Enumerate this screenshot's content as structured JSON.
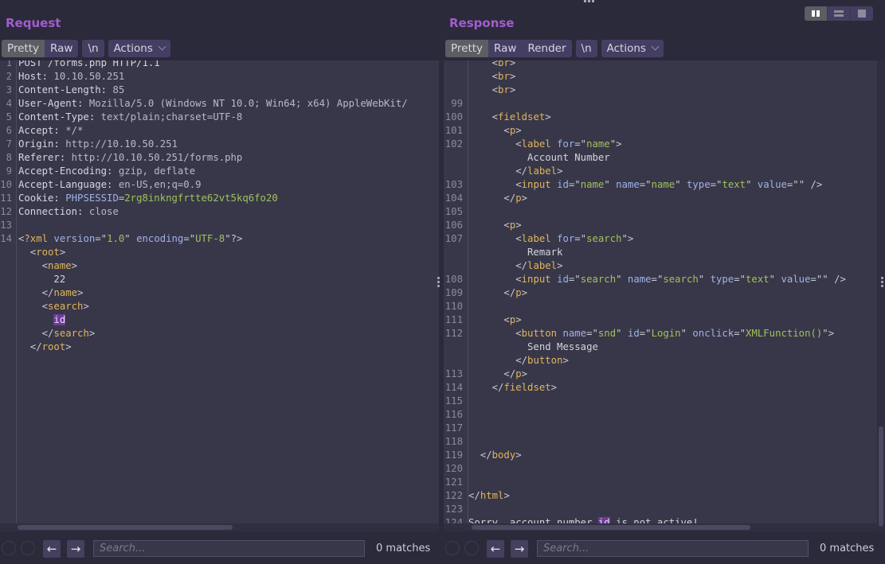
{
  "layout_switch": [
    "side-by-side",
    "stacked",
    "single"
  ],
  "request": {
    "title": "Request",
    "tabs": [
      {
        "label": "Pretty",
        "active": true
      },
      {
        "label": "Raw",
        "active": false
      }
    ],
    "newline_label": "\\n",
    "actions_label": "Actions",
    "lines": [
      {
        "n": "1",
        "parts": [
          {
            "c": "hk",
            "t": "POST /forms.php HTTP/1.1"
          }
        ]
      },
      {
        "n": "2",
        "parts": [
          {
            "c": "hk",
            "t": "Host: "
          },
          {
            "c": "hv",
            "t": "10.10.50.251"
          }
        ]
      },
      {
        "n": "3",
        "parts": [
          {
            "c": "hk",
            "t": "Content-Length: "
          },
          {
            "c": "hv",
            "t": "85"
          }
        ]
      },
      {
        "n": "4",
        "parts": [
          {
            "c": "hk",
            "t": "User-Agent: "
          },
          {
            "c": "hv",
            "t": "Mozilla/5.0 (Windows NT 10.0; Win64; x64) AppleWebKit/"
          }
        ]
      },
      {
        "n": "5",
        "parts": [
          {
            "c": "hk",
            "t": "Content-Type: "
          },
          {
            "c": "hv",
            "t": "text/plain;charset=UTF-8"
          }
        ]
      },
      {
        "n": "6",
        "parts": [
          {
            "c": "hk",
            "t": "Accept: "
          },
          {
            "c": "hv",
            "t": "*/*"
          }
        ]
      },
      {
        "n": "7",
        "parts": [
          {
            "c": "hk",
            "t": "Origin: "
          },
          {
            "c": "hv",
            "t": "http://10.10.50.251"
          }
        ]
      },
      {
        "n": "8",
        "parts": [
          {
            "c": "hk",
            "t": "Referer: "
          },
          {
            "c": "hv",
            "t": "http://10.10.50.251/forms.php"
          }
        ]
      },
      {
        "n": "9",
        "parts": [
          {
            "c": "hk",
            "t": "Accept-Encoding: "
          },
          {
            "c": "hv",
            "t": "gzip, deflate"
          }
        ]
      },
      {
        "n": "10",
        "parts": [
          {
            "c": "hk",
            "t": "Accept-Language: "
          },
          {
            "c": "hv",
            "t": "en-US,en;q=0.9"
          }
        ]
      },
      {
        "n": "11",
        "parts": [
          {
            "c": "hk",
            "t": "Cookie: "
          },
          {
            "c": "attr",
            "t": "PHPSESSID"
          },
          {
            "c": "punct",
            "t": "="
          },
          {
            "c": "cookie",
            "t": "2rg8inkngfrtte62vt5kq6fo20"
          }
        ]
      },
      {
        "n": "12",
        "parts": [
          {
            "c": "hk",
            "t": "Connection: "
          },
          {
            "c": "hv",
            "t": "close"
          }
        ]
      },
      {
        "n": "13",
        "parts": []
      },
      {
        "n": "14",
        "parts": [
          {
            "c": "punct",
            "t": "<"
          },
          {
            "c": "tag",
            "t": "?xml "
          },
          {
            "c": "attr",
            "t": "version"
          },
          {
            "c": "punct",
            "t": "=\""
          },
          {
            "c": "str",
            "t": "1.0"
          },
          {
            "c": "punct",
            "t": "\" "
          },
          {
            "c": "attr",
            "t": "encoding"
          },
          {
            "c": "punct",
            "t": "=\""
          },
          {
            "c": "str",
            "t": "UTF-8"
          },
          {
            "c": "punct",
            "t": "\"?>"
          }
        ]
      },
      {
        "n": "",
        "parts": [
          {
            "c": "txt",
            "t": "  "
          },
          {
            "c": "punct",
            "t": "<"
          },
          {
            "c": "tag",
            "t": "root"
          },
          {
            "c": "punct",
            "t": ">"
          }
        ]
      },
      {
        "n": "",
        "parts": [
          {
            "c": "txt",
            "t": "    "
          },
          {
            "c": "punct",
            "t": "<"
          },
          {
            "c": "tag",
            "t": "name"
          },
          {
            "c": "punct",
            "t": ">"
          }
        ]
      },
      {
        "n": "",
        "parts": [
          {
            "c": "txt",
            "t": "      22"
          }
        ]
      },
      {
        "n": "",
        "parts": [
          {
            "c": "txt",
            "t": "    "
          },
          {
            "c": "punct",
            "t": "</"
          },
          {
            "c": "tag",
            "t": "name"
          },
          {
            "c": "punct",
            "t": ">"
          }
        ]
      },
      {
        "n": "",
        "parts": [
          {
            "c": "txt",
            "t": "    "
          },
          {
            "c": "punct",
            "t": "<"
          },
          {
            "c": "tag",
            "t": "search"
          },
          {
            "c": "punct",
            "t": ">"
          }
        ]
      },
      {
        "n": "",
        "parts": [
          {
            "c": "txt",
            "t": "      "
          },
          {
            "c": "hl",
            "t": "id"
          }
        ]
      },
      {
        "n": "",
        "parts": [
          {
            "c": "txt",
            "t": "    "
          },
          {
            "c": "punct",
            "t": "</"
          },
          {
            "c": "tag",
            "t": "search"
          },
          {
            "c": "punct",
            "t": ">"
          }
        ]
      },
      {
        "n": "",
        "parts": [
          {
            "c": "txt",
            "t": "  "
          },
          {
            "c": "punct",
            "t": "</"
          },
          {
            "c": "tag",
            "t": "root"
          },
          {
            "c": "punct",
            "t": ">"
          }
        ]
      }
    ],
    "search_placeholder": "Search...",
    "search_value": "",
    "matches": "0 matches"
  },
  "response": {
    "title": "Response",
    "tabs": [
      {
        "label": "Pretty",
        "active": true
      },
      {
        "label": "Raw",
        "active": false
      },
      {
        "label": "Render",
        "active": false
      }
    ],
    "newline_label": "\\n",
    "actions_label": "Actions",
    "lines": [
      {
        "n": "",
        "parts": [
          {
            "c": "txt",
            "t": "    "
          },
          {
            "c": "punct",
            "t": "<"
          },
          {
            "c": "tag",
            "t": "br"
          },
          {
            "c": "punct",
            "t": ">"
          }
        ]
      },
      {
        "n": "",
        "parts": [
          {
            "c": "txt",
            "t": "    "
          },
          {
            "c": "punct",
            "t": "<"
          },
          {
            "c": "tag",
            "t": "br"
          },
          {
            "c": "punct",
            "t": ">"
          }
        ]
      },
      {
        "n": "",
        "parts": [
          {
            "c": "txt",
            "t": "    "
          },
          {
            "c": "punct",
            "t": "<"
          },
          {
            "c": "tag",
            "t": "br"
          },
          {
            "c": "punct",
            "t": ">"
          }
        ]
      },
      {
        "n": "99",
        "parts": []
      },
      {
        "n": "100",
        "parts": [
          {
            "c": "txt",
            "t": "    "
          },
          {
            "c": "punct",
            "t": "<"
          },
          {
            "c": "tag",
            "t": "fieldset"
          },
          {
            "c": "punct",
            "t": ">"
          }
        ]
      },
      {
        "n": "101",
        "parts": [
          {
            "c": "txt",
            "t": "      "
          },
          {
            "c": "punct",
            "t": "<"
          },
          {
            "c": "tag",
            "t": "p"
          },
          {
            "c": "punct",
            "t": ">"
          }
        ]
      },
      {
        "n": "102",
        "parts": [
          {
            "c": "txt",
            "t": "        "
          },
          {
            "c": "punct",
            "t": "<"
          },
          {
            "c": "tag",
            "t": "label "
          },
          {
            "c": "attr",
            "t": "for"
          },
          {
            "c": "punct",
            "t": "=\""
          },
          {
            "c": "str",
            "t": "name"
          },
          {
            "c": "punct",
            "t": "\">"
          }
        ]
      },
      {
        "n": "",
        "parts": [
          {
            "c": "txt",
            "t": "          Account Number"
          }
        ]
      },
      {
        "n": "",
        "parts": [
          {
            "c": "txt",
            "t": "        "
          },
          {
            "c": "punct",
            "t": "</"
          },
          {
            "c": "tag",
            "t": "label"
          },
          {
            "c": "punct",
            "t": ">"
          }
        ]
      },
      {
        "n": "103",
        "parts": [
          {
            "c": "txt",
            "t": "        "
          },
          {
            "c": "punct",
            "t": "<"
          },
          {
            "c": "tag",
            "t": "input "
          },
          {
            "c": "attr",
            "t": "id"
          },
          {
            "c": "punct",
            "t": "=\""
          },
          {
            "c": "str",
            "t": "name"
          },
          {
            "c": "punct",
            "t": "\" "
          },
          {
            "c": "attr",
            "t": "name"
          },
          {
            "c": "punct",
            "t": "=\""
          },
          {
            "c": "str",
            "t": "name"
          },
          {
            "c": "punct",
            "t": "\" "
          },
          {
            "c": "attr",
            "t": "type"
          },
          {
            "c": "punct",
            "t": "=\""
          },
          {
            "c": "str",
            "t": "text"
          },
          {
            "c": "punct",
            "t": "\" "
          },
          {
            "c": "attr",
            "t": "value"
          },
          {
            "c": "punct",
            "t": "=\"\" />"
          }
        ]
      },
      {
        "n": "104",
        "parts": [
          {
            "c": "txt",
            "t": "      "
          },
          {
            "c": "punct",
            "t": "</"
          },
          {
            "c": "tag",
            "t": "p"
          },
          {
            "c": "punct",
            "t": ">"
          }
        ]
      },
      {
        "n": "105",
        "parts": []
      },
      {
        "n": "106",
        "parts": [
          {
            "c": "txt",
            "t": "      "
          },
          {
            "c": "punct",
            "t": "<"
          },
          {
            "c": "tag",
            "t": "p"
          },
          {
            "c": "punct",
            "t": ">"
          }
        ]
      },
      {
        "n": "107",
        "parts": [
          {
            "c": "txt",
            "t": "        "
          },
          {
            "c": "punct",
            "t": "<"
          },
          {
            "c": "tag",
            "t": "label "
          },
          {
            "c": "attr",
            "t": "for"
          },
          {
            "c": "punct",
            "t": "=\""
          },
          {
            "c": "str",
            "t": "search"
          },
          {
            "c": "punct",
            "t": "\">"
          }
        ]
      },
      {
        "n": "",
        "parts": [
          {
            "c": "txt",
            "t": "          Remark"
          }
        ]
      },
      {
        "n": "",
        "parts": [
          {
            "c": "txt",
            "t": "        "
          },
          {
            "c": "punct",
            "t": "</"
          },
          {
            "c": "tag",
            "t": "label"
          },
          {
            "c": "punct",
            "t": ">"
          }
        ]
      },
      {
        "n": "108",
        "parts": [
          {
            "c": "txt",
            "t": "        "
          },
          {
            "c": "punct",
            "t": "<"
          },
          {
            "c": "tag",
            "t": "input "
          },
          {
            "c": "attr",
            "t": "id"
          },
          {
            "c": "punct",
            "t": "=\""
          },
          {
            "c": "str",
            "t": "search"
          },
          {
            "c": "punct",
            "t": "\" "
          },
          {
            "c": "attr",
            "t": "name"
          },
          {
            "c": "punct",
            "t": "=\""
          },
          {
            "c": "str",
            "t": "search"
          },
          {
            "c": "punct",
            "t": "\" "
          },
          {
            "c": "attr",
            "t": "type"
          },
          {
            "c": "punct",
            "t": "=\""
          },
          {
            "c": "str",
            "t": "text"
          },
          {
            "c": "punct",
            "t": "\" "
          },
          {
            "c": "attr",
            "t": "value"
          },
          {
            "c": "punct",
            "t": "=\"\" />"
          }
        ]
      },
      {
        "n": "109",
        "parts": [
          {
            "c": "txt",
            "t": "      "
          },
          {
            "c": "punct",
            "t": "</"
          },
          {
            "c": "tag",
            "t": "p"
          },
          {
            "c": "punct",
            "t": ">"
          }
        ]
      },
      {
        "n": "110",
        "parts": []
      },
      {
        "n": "111",
        "parts": [
          {
            "c": "txt",
            "t": "      "
          },
          {
            "c": "punct",
            "t": "<"
          },
          {
            "c": "tag",
            "t": "p"
          },
          {
            "c": "punct",
            "t": ">"
          }
        ]
      },
      {
        "n": "112",
        "parts": [
          {
            "c": "txt",
            "t": "        "
          },
          {
            "c": "punct",
            "t": "<"
          },
          {
            "c": "tag",
            "t": "button "
          },
          {
            "c": "attr",
            "t": "name"
          },
          {
            "c": "punct",
            "t": "=\""
          },
          {
            "c": "str",
            "t": "snd"
          },
          {
            "c": "punct",
            "t": "\" "
          },
          {
            "c": "attr",
            "t": "id"
          },
          {
            "c": "punct",
            "t": "=\""
          },
          {
            "c": "str",
            "t": "Login"
          },
          {
            "c": "punct",
            "t": "\" "
          },
          {
            "c": "attr",
            "t": "onclick"
          },
          {
            "c": "punct",
            "t": "=\""
          },
          {
            "c": "str",
            "t": "XMLFunction()"
          },
          {
            "c": "punct",
            "t": "\">"
          }
        ]
      },
      {
        "n": "",
        "parts": [
          {
            "c": "txt",
            "t": "          Send Message"
          }
        ]
      },
      {
        "n": "",
        "parts": [
          {
            "c": "txt",
            "t": "        "
          },
          {
            "c": "punct",
            "t": "</"
          },
          {
            "c": "tag",
            "t": "button"
          },
          {
            "c": "punct",
            "t": ">"
          }
        ]
      },
      {
        "n": "113",
        "parts": [
          {
            "c": "txt",
            "t": "      "
          },
          {
            "c": "punct",
            "t": "</"
          },
          {
            "c": "tag",
            "t": "p"
          },
          {
            "c": "punct",
            "t": ">"
          }
        ]
      },
      {
        "n": "114",
        "parts": [
          {
            "c": "txt",
            "t": "    "
          },
          {
            "c": "punct",
            "t": "</"
          },
          {
            "c": "tag",
            "t": "fieldset"
          },
          {
            "c": "punct",
            "t": ">"
          }
        ]
      },
      {
        "n": "115",
        "parts": []
      },
      {
        "n": "116",
        "parts": []
      },
      {
        "n": "117",
        "parts": []
      },
      {
        "n": "118",
        "parts": []
      },
      {
        "n": "119",
        "parts": [
          {
            "c": "txt",
            "t": "  "
          },
          {
            "c": "punct",
            "t": "</"
          },
          {
            "c": "tag",
            "t": "body"
          },
          {
            "c": "punct",
            "t": ">"
          }
        ]
      },
      {
        "n": "120",
        "parts": []
      },
      {
        "n": "121",
        "parts": []
      },
      {
        "n": "122",
        "parts": [
          {
            "c": "punct",
            "t": "</"
          },
          {
            "c": "tag",
            "t": "html"
          },
          {
            "c": "punct",
            "t": ">"
          }
        ]
      },
      {
        "n": "123",
        "parts": []
      },
      {
        "n": "124",
        "parts": [
          {
            "c": "txt",
            "t": "Sorry, account number "
          },
          {
            "c": "hl",
            "t": "id"
          },
          {
            "c": "txt",
            "t": " is not active!"
          }
        ]
      }
    ],
    "search_placeholder": "Search...",
    "search_value": "",
    "matches": "0 matches"
  }
}
